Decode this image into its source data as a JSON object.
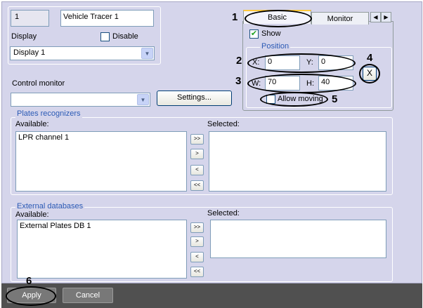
{
  "general": {
    "id_value": "1",
    "name_value": "Vehicle Tracer 1",
    "display_label": "Display",
    "disable_label": "Disable",
    "display_select": "Display 1"
  },
  "control_monitor": {
    "label": "Control monitor",
    "select_value": "",
    "settings_label": "Settings..."
  },
  "tabs": {
    "basic": "Basic",
    "monitor": "Monitor"
  },
  "basic_panel": {
    "show_label": "Show",
    "position_title": "Position",
    "x_label": "X:",
    "x_value": "0",
    "y_label": "Y:",
    "y_value": "0",
    "w_label": "W:",
    "w_value": "70",
    "h_label": "H:",
    "h_value": "40",
    "close_label": "X",
    "allow_moving_label": "Allow moving"
  },
  "plates": {
    "title": "Plates recognizers",
    "available_label": "Available:",
    "selected_label": "Selected:",
    "available_items": [
      "LPR channel 1"
    ],
    "selected_items": [],
    "buttons": [
      ">>",
      ">",
      "<",
      "<<"
    ]
  },
  "external": {
    "title": "External databases",
    "available_label": "Available:",
    "selected_label": "Selected:",
    "available_items": [
      "External Plates DB 1"
    ],
    "selected_items": [],
    "buttons": [
      ">>",
      ">",
      "<",
      "<<"
    ]
  },
  "footer": {
    "apply_label": "Apply",
    "cancel_label": "Cancel"
  },
  "callouts": [
    "1",
    "2",
    "3",
    "4",
    "5",
    "6"
  ],
  "icons": {
    "checkmark": "check-icon",
    "dropdown": "chevron-down-icon",
    "tab_scroll_left": "chevron-left-icon",
    "tab_scroll_right": "chevron-right-icon"
  }
}
